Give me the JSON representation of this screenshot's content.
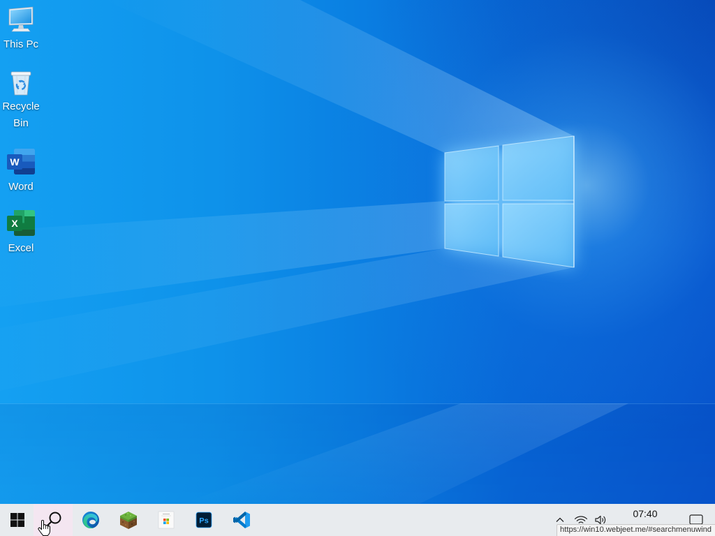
{
  "desktop": {
    "icons": [
      {
        "label": "This Pc",
        "icon": "this-pc-icon"
      },
      {
        "label": "Recycle Bin",
        "icon": "recycle-bin-icon"
      },
      {
        "label": "Word",
        "icon": "word-icon",
        "logo_letter": "W"
      },
      {
        "label": "Excel",
        "icon": "excel-icon",
        "logo_letter": "X"
      }
    ]
  },
  "taskbar": {
    "start_icon": "windows-logo-icon",
    "search_icon": "search-icon",
    "search_hovered": true,
    "pinned": [
      {
        "icon": "edge-icon"
      },
      {
        "icon": "minecraft-icon"
      },
      {
        "icon": "microsoft-store-icon"
      },
      {
        "icon": "photoshop-icon",
        "logo_letters": "Ps"
      },
      {
        "icon": "vscode-icon"
      }
    ],
    "tray": {
      "show_hidden_icon": "chevron-up-icon",
      "network_icon": "wifi-icon",
      "volume_icon": "volume-icon",
      "time": "07:40",
      "action_center_icon": "notification-icon"
    }
  },
  "browser_status": {
    "link_url": "https://win10.webjeet.me/#searchmenuwind"
  },
  "colors": {
    "taskbar_bg": "#e8ebee",
    "search_hover_bg": "#f4e6f1",
    "label_text": "#ffffff",
    "status_bg": "#f4f4f4",
    "photoshop_bg": "#001e36",
    "photoshop_accent": "#31a8ff",
    "word_blue": "#185abd",
    "excel_green": "#107c41",
    "vscode_blue": "#007acc",
    "wallpaper_blue": "#0a7fe0"
  }
}
